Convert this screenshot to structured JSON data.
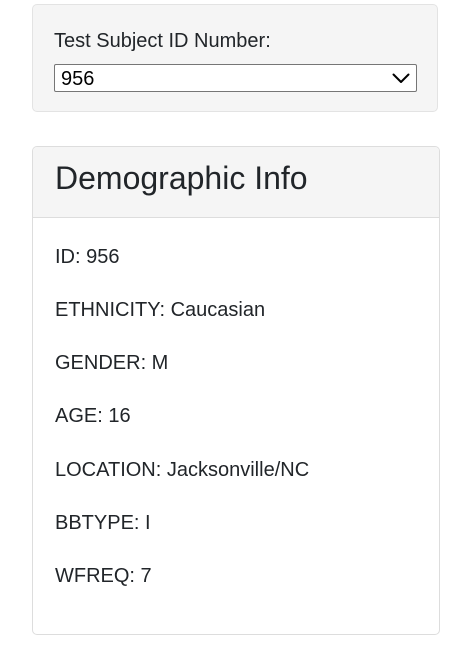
{
  "selector": {
    "label": "Test Subject ID Number:",
    "selected_value": "956",
    "chevron_icon": "chevron-down-icon"
  },
  "panel": {
    "title": "Demographic Info",
    "lines": [
      "ID: 956",
      "ETHNICITY: Caucasian",
      "GENDER: M",
      "AGE: 16",
      "LOCATION: Jacksonville/NC",
      "BBTYPE: I",
      "WFREQ: 7"
    ]
  },
  "colors": {
    "well_background": "#f5f5f5",
    "panel_heading_background": "#f5f5f5",
    "border": "#dddddd",
    "text": "#212529"
  }
}
